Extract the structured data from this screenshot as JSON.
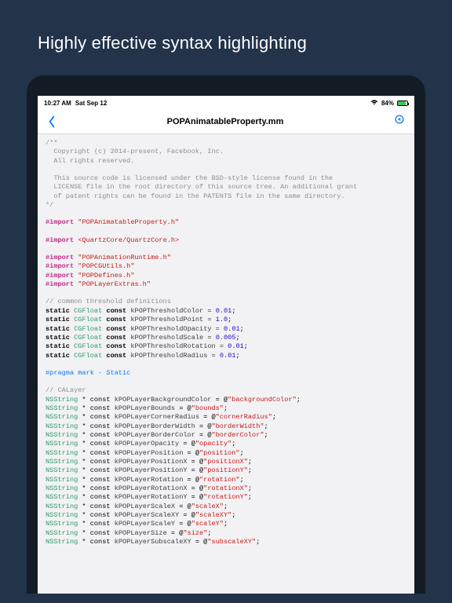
{
  "hero": {
    "title": "Highly effective syntax highlighting"
  },
  "statusbar": {
    "time": "10:27 AM",
    "date": "Sat Sep 12",
    "battery_pct": "84%"
  },
  "navbar": {
    "title": "POPAnimatableProperty.mm"
  },
  "code": {
    "copyright_open": "/**",
    "copyright_l1": "  Copyright (c) 2014-present, Facebook, Inc.",
    "copyright_l2": "  All rights reserved.",
    "copyright_l3": "  This source code is licensed under the BSD-style license found in the",
    "copyright_l4": "  LICENSE file in the root directory of this source tree. An additional grant",
    "copyright_l5": "  of patent rights can be found in the PATENTS file in the same directory.",
    "copyright_close": "*/",
    "import_kw": "#import",
    "import1": "\"POPAnimatableProperty.h\"",
    "import2": "<QuartzCore/QuartzCore.h>",
    "import3": "\"POPAnimationRuntime.h\"",
    "import4": "\"POPCGUtils.h\"",
    "import5": "\"POPDefines.h\"",
    "import6": "\"POPLayerExtras.h\"",
    "common_thresh": "// common threshold definitions",
    "static_kw": "static",
    "cgfloat": "CGFloat",
    "const_kw": "const",
    "thColor": "kPOPThresholdColor = ",
    "thPoint": "kPOPThresholdPoint = ",
    "thOpacity": "kPOPThresholdOpacity = ",
    "thScale": "kPOPThresholdScale = ",
    "thRotation": "kPOPThresholdRotation = ",
    "thRadius": "kPOPThresholdRadius = ",
    "v001": "0.01",
    "v10": "1.0",
    "v0005": "0.005",
    "semi": ";",
    "pragma_static": "#pragma mark - Static",
    "calayer_comment": "// CALayer",
    "nsstring": "NSString",
    "star_const": " * const ",
    "eq_at": " = @",
    "p_bg": "kPOPLayerBackgroundColor",
    "s_bg": "\"backgroundColor\"",
    "p_bounds": "kPOPLayerBounds",
    "s_bounds": "\"bounds\"",
    "p_corner": "kPOPLayerCornerRadius",
    "s_corner": "\"cornerRadius\"",
    "p_bw": "kPOPLayerBorderWidth",
    "s_bw": "\"borderWidth\"",
    "p_bc": "kPOPLayerBorderColor",
    "s_bc": "\"borderColor\"",
    "p_op": "kPOPLayerOpacity",
    "s_op": "\"opacity\"",
    "p_pos": "kPOPLayerPosition",
    "s_pos": "\"position\"",
    "p_posx": "kPOPLayerPositionX",
    "s_posx": "\"positionX\"",
    "p_posy": "kPOPLayerPositionY",
    "s_posy": "\"positionY\"",
    "p_rot": "kPOPLayerRotation",
    "s_rot": "\"rotation\"",
    "p_rotx": "kPOPLayerRotationX",
    "s_rotx": "\"rotationX\"",
    "p_roty": "kPOPLayerRotationY",
    "s_roty": "\"rotationY\"",
    "p_scx": "kPOPLayerScaleX",
    "s_scx": "\"scaleX\"",
    "p_scxy": "kPOPLayerScaleXY",
    "s_scxy": "\"scaleXY\"",
    "p_scy": "kPOPLayerScaleY",
    "s_scy": "\"scaleY\"",
    "p_size": "kPOPLayerSize",
    "s_size": "\"size\"",
    "p_subx": "kPOPLayerSubscaleXY",
    "s_subx": "\"subscaleXY\""
  }
}
